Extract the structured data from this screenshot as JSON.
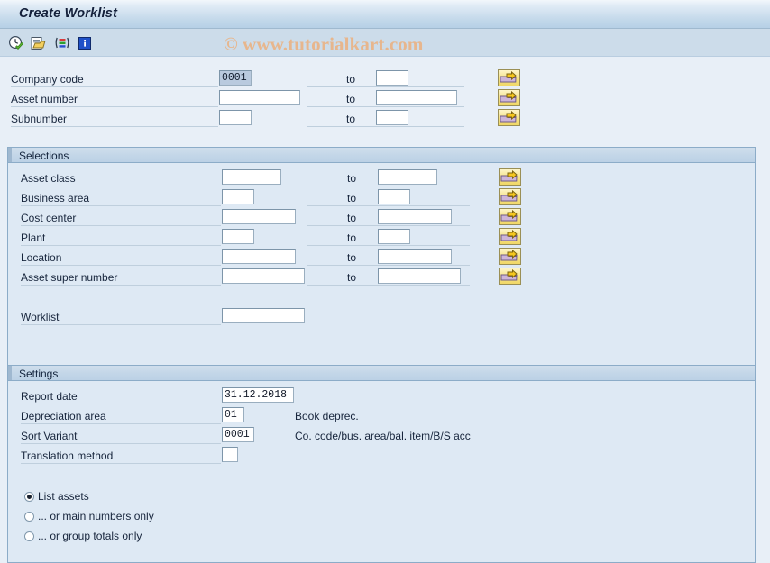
{
  "window": {
    "title": "Create Worklist"
  },
  "watermark": "© www.tutorialkart.com",
  "toolbar": {
    "items": [
      {
        "name": "execute-icon",
        "label": "Execute"
      },
      {
        "name": "get-variant-icon",
        "label": "Get Variant"
      },
      {
        "name": "multiple-selection-icon",
        "label": "Multiple Selection"
      },
      {
        "name": "information-icon",
        "label": "Information"
      }
    ]
  },
  "top_section": {
    "rows": [
      {
        "label": "Company code",
        "value": "0001",
        "selected": true,
        "to_label": "to",
        "to_value": "",
        "arrow_label": "Multiple selection for Company code"
      },
      {
        "label": "Asset number",
        "value": "",
        "selected": false,
        "to_label": "to",
        "to_value": "",
        "arrow_label": "Multiple selection for Asset number"
      },
      {
        "label": "Subnumber",
        "value": "",
        "selected": false,
        "to_label": "to",
        "to_value": "",
        "arrow_label": "Multiple selection for Subnumber"
      }
    ]
  },
  "selections": {
    "header": "Selections",
    "rows": [
      {
        "label": "Asset class",
        "value": "",
        "to_label": "to",
        "to_value": "",
        "arrow_label": "Multiple selection for Asset class"
      },
      {
        "label": "Business area",
        "value": "",
        "to_label": "to",
        "to_value": "",
        "arrow_label": "Multiple selection for Business area"
      },
      {
        "label": "Cost center",
        "value": "",
        "to_label": "to",
        "to_value": "",
        "arrow_label": "Multiple selection for Cost center"
      },
      {
        "label": "Plant",
        "value": "",
        "to_label": "to",
        "to_value": "",
        "arrow_label": "Multiple selection for Plant"
      },
      {
        "label": "Location",
        "value": "",
        "to_label": "to",
        "to_value": "",
        "arrow_label": "Multiple selection for Location"
      },
      {
        "label": "Asset super number",
        "value": "",
        "to_label": "to",
        "to_value": "",
        "arrow_label": "Multiple selection for Asset super number"
      }
    ],
    "worklist": {
      "label": "Worklist",
      "value": ""
    }
  },
  "settings": {
    "header": "Settings",
    "rows": [
      {
        "label": "Report date",
        "value": "31.12.2018",
        "desc": ""
      },
      {
        "label": "Depreciation area",
        "value": "01",
        "desc": "Book deprec."
      },
      {
        "label": "Sort Variant",
        "value": "0001",
        "desc": "Co. code/bus. area/bal. item/B/S acc"
      },
      {
        "label": "Translation method",
        "value": "",
        "desc": ""
      }
    ],
    "radios": [
      {
        "label": "List assets",
        "checked": true
      },
      {
        "label": "... or main numbers only",
        "checked": false
      },
      {
        "label": "... or group totals only",
        "checked": false
      }
    ]
  },
  "colors": {
    "background": "#e8eff7",
    "panel": "#dee9f4",
    "panel_border": "#8cacc8",
    "titlebar_accent": "#b6d0e6",
    "button_yellow": "#f3dd78",
    "watermark": "#e7b68d",
    "field_selected": "#b9cade"
  }
}
